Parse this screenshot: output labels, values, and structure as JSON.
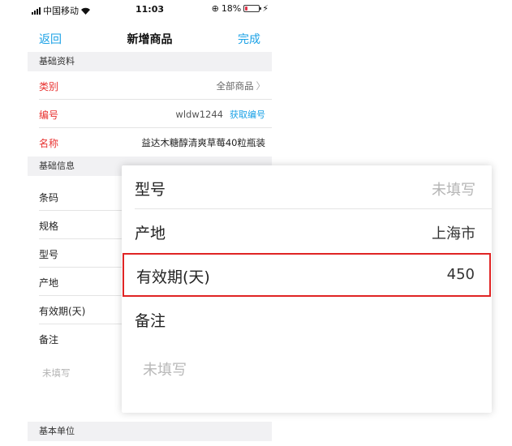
{
  "status_bar": {
    "carrier": "中国移动",
    "time": "11:03",
    "battery_percent": "18%",
    "battery_level": 0.18
  },
  "nav": {
    "back_label": "返回",
    "title": "新增商品",
    "done_label": "完成"
  },
  "sections": {
    "basic_data": "基础资料",
    "basic_info": "基础信息",
    "basic_unit": "基本单位"
  },
  "basic_data_rows": {
    "category": {
      "label": "类别",
      "value": "全部商品"
    },
    "code": {
      "label": "编号",
      "value": "wldw1244",
      "action": "获取编号"
    },
    "name": {
      "label": "名称",
      "value": "益达木糖醇清爽草莓40粒瓶装"
    }
  },
  "basic_info_rows": {
    "barcode": {
      "label": "条码"
    },
    "spec": {
      "label": "规格"
    },
    "model": {
      "label": "型号"
    },
    "origin": {
      "label": "产地"
    },
    "shelf_life": {
      "label": "有效期(天)"
    },
    "remark": {
      "label": "备注",
      "placeholder": "未填写"
    }
  },
  "zoom_card": {
    "model": {
      "label": "型号",
      "value": "未填写"
    },
    "origin": {
      "label": "产地",
      "value": "上海市"
    },
    "shelf_life": {
      "label": "有效期(天)",
      "value": "450"
    },
    "remark": {
      "label": "备注",
      "placeholder": "未填写"
    }
  },
  "colors": {
    "accent": "#1aa1e6",
    "required_label": "#e8312f",
    "highlight_border": "#e02424",
    "section_bg": "#f1f1f3"
  }
}
